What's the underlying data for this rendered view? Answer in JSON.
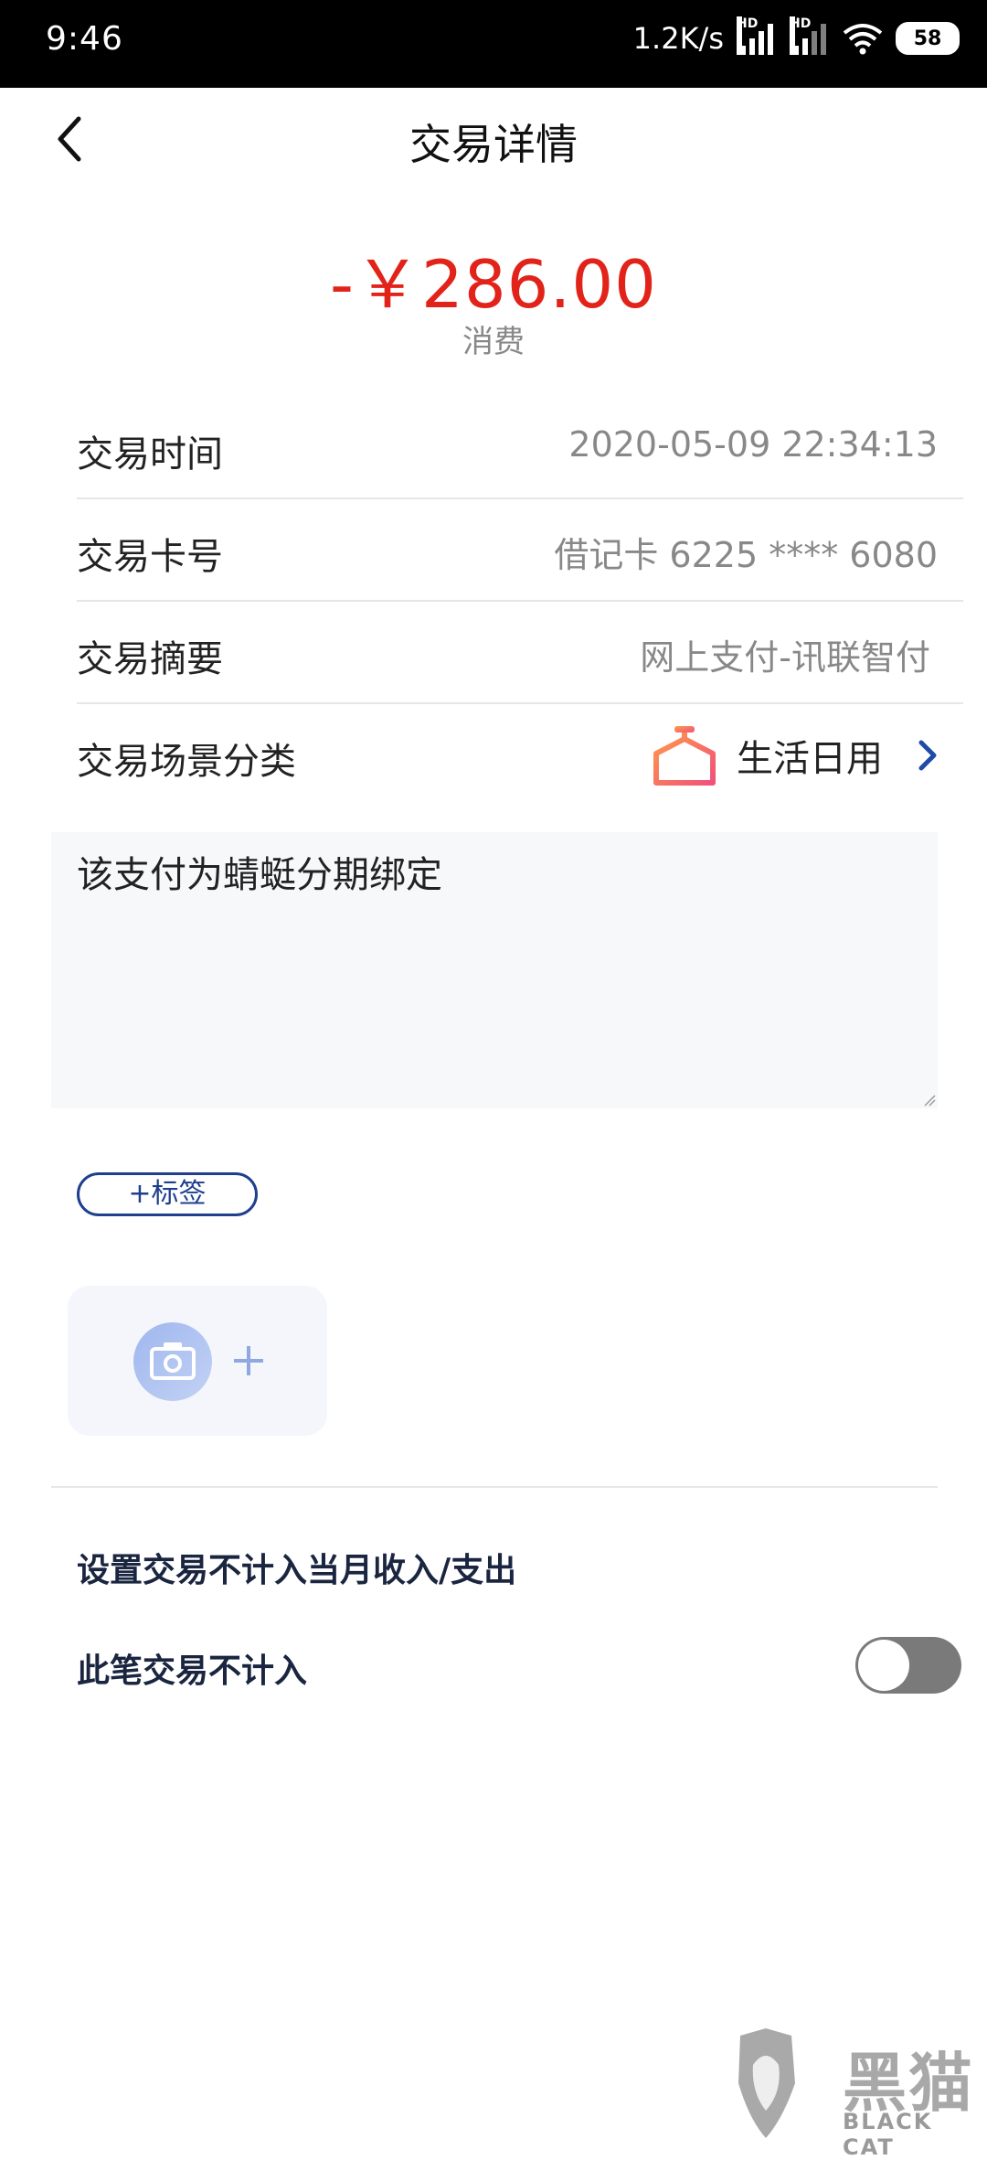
{
  "status_bar": {
    "time": "9:46",
    "network_speed": "1.2K/s",
    "signal_badge": "HD",
    "battery": "58"
  },
  "nav": {
    "title": "交易详情"
  },
  "amount": {
    "value": "-￥286.00",
    "type": "消费",
    "color": "#e2231a"
  },
  "details": [
    {
      "label": "交易时间",
      "value": "2020-05-09 22:34:13"
    },
    {
      "label": "交易卡号",
      "value": "借记卡 6225 **** 6080"
    },
    {
      "label": "交易摘要",
      "value": "网上支付-讯联智付"
    },
    {
      "label": "交易场景分类",
      "value": "生活日用",
      "icon": "hanger-icon"
    }
  ],
  "note": {
    "text": "该支付为蜻蜓分期绑定"
  },
  "tag_button": {
    "label": "+标签"
  },
  "settings": {
    "heading": "设置交易不计入当月收入/支出",
    "exclude_label": "此笔交易不计入",
    "exclude_enabled": false
  },
  "watermark": {
    "text": "黑猫",
    "sub": "BLACK CAT"
  }
}
